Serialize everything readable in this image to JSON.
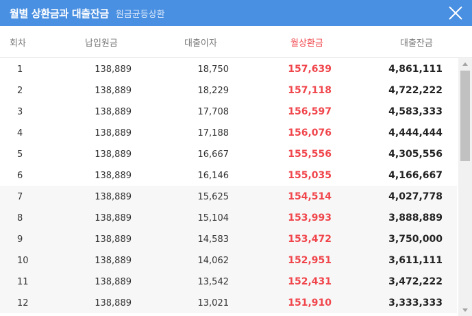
{
  "dialog": {
    "title": "월별 상환금과 대출잔금",
    "subtitle": "원금균등상환"
  },
  "columns": {
    "no": "회차",
    "principal": "납입원금",
    "interest": "대출이자",
    "monthly": "월상환금",
    "balance": "대출잔금"
  },
  "colors": {
    "header_bg": "#4a90e2",
    "accent_red": "#f0454b"
  },
  "rows": [
    {
      "no": "1",
      "principal": "138,889",
      "interest": "18,750",
      "monthly": "157,639",
      "balance": "4,861,111"
    },
    {
      "no": "2",
      "principal": "138,889",
      "interest": "18,229",
      "monthly": "157,118",
      "balance": "4,722,222"
    },
    {
      "no": "3",
      "principal": "138,889",
      "interest": "17,708",
      "monthly": "156,597",
      "balance": "4,583,333"
    },
    {
      "no": "4",
      "principal": "138,889",
      "interest": "17,188",
      "monthly": "156,076",
      "balance": "4,444,444"
    },
    {
      "no": "5",
      "principal": "138,889",
      "interest": "16,667",
      "monthly": "155,556",
      "balance": "4,305,556"
    },
    {
      "no": "6",
      "principal": "138,889",
      "interest": "16,146",
      "monthly": "155,035",
      "balance": "4,166,667"
    },
    {
      "no": "7",
      "principal": "138,889",
      "interest": "15,625",
      "monthly": "154,514",
      "balance": "4,027,778"
    },
    {
      "no": "8",
      "principal": "138,889",
      "interest": "15,104",
      "monthly": "153,993",
      "balance": "3,888,889"
    },
    {
      "no": "9",
      "principal": "138,889",
      "interest": "14,583",
      "monthly": "153,472",
      "balance": "3,750,000"
    },
    {
      "no": "10",
      "principal": "138,889",
      "interest": "14,062",
      "monthly": "152,951",
      "balance": "3,611,111"
    },
    {
      "no": "11",
      "principal": "138,889",
      "interest": "13,542",
      "monthly": "152,431",
      "balance": "3,472,222"
    },
    {
      "no": "12",
      "principal": "138,889",
      "interest": "13,021",
      "monthly": "151,910",
      "balance": "3,333,333"
    }
  ]
}
